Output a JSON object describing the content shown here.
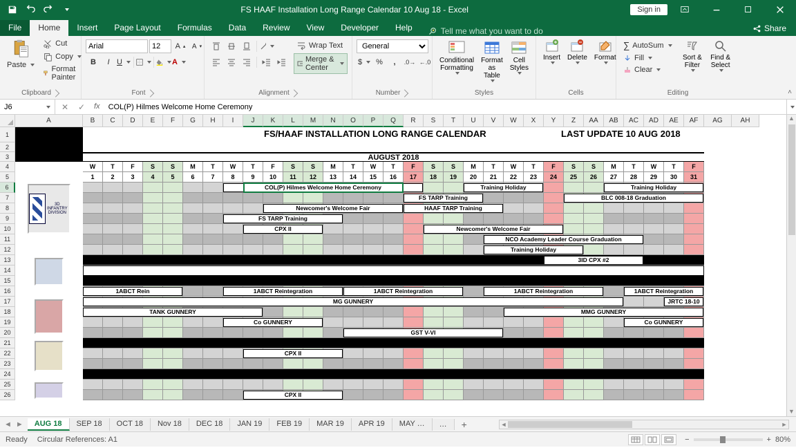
{
  "titlebar": {
    "doc_title": "FS HAAF Installation Long Range Calendar 10 Aug 18  -  Excel",
    "signin": "Sign in"
  },
  "menu": {
    "items": [
      "File",
      "Home",
      "Insert",
      "Page Layout",
      "Formulas",
      "Data",
      "Review",
      "View",
      "Developer",
      "Help"
    ],
    "active": "Home",
    "tell_placeholder": "Tell me what you want to do",
    "share": "Share"
  },
  "ribbon": {
    "clipboard": {
      "paste": "Paste",
      "cut": "Cut",
      "copy": "Copy",
      "painter": "Format Painter",
      "label": "Clipboard"
    },
    "font": {
      "name": "Arial",
      "size": "12",
      "label": "Font"
    },
    "alignment": {
      "wrap": "Wrap Text",
      "merge": "Merge & Center",
      "label": "Alignment"
    },
    "number": {
      "format": "General",
      "label": "Number"
    },
    "styles": {
      "cond": "Conditional Formatting",
      "table": "Format as Table",
      "cell": "Cell Styles",
      "label": "Styles"
    },
    "cells": {
      "insert": "Insert",
      "delete": "Delete",
      "format": "Format",
      "label": "Cells"
    },
    "editing": {
      "autosum": "AutoSum",
      "fill": "Fill",
      "clear": "Clear",
      "sort": "Sort & Filter",
      "find": "Find & Select",
      "label": "Editing"
    }
  },
  "namebox": {
    "cell": "J6",
    "formula": "COL(P) Hilmes Welcome Home Ceremony"
  },
  "columns": [
    "A",
    "B",
    "C",
    "D",
    "E",
    "F",
    "G",
    "H",
    "I",
    "J",
    "K",
    "L",
    "M",
    "N",
    "O",
    "P",
    "Q",
    "R",
    "S",
    "T",
    "U",
    "V",
    "W",
    "X",
    "Y",
    "Z",
    "AA",
    "AB",
    "AC",
    "AD",
    "AE",
    "AF",
    "AG",
    "AH"
  ],
  "sheet": {
    "title": "FS/HAAF INSTALLATION LONG RANGE CALENDAR",
    "update": "LAST UPDATE 10 AUG 2018",
    "month": "AUGUST 2018",
    "dow": [
      "W",
      "T",
      "F",
      "S",
      "S",
      "M",
      "T",
      "W",
      "T",
      "F",
      "S",
      "S",
      "M",
      "T",
      "W",
      "T",
      "F",
      "S",
      "S",
      "M",
      "T",
      "W",
      "T",
      "F",
      "S",
      "S",
      "M",
      "T",
      "W",
      "T",
      "F"
    ],
    "dom": [
      "1",
      "2",
      "3",
      "4",
      "5",
      "6",
      "7",
      "8",
      "9",
      "10",
      "11",
      "12",
      "13",
      "14",
      "15",
      "16",
      "17",
      "18",
      "19",
      "20",
      "21",
      "22",
      "23",
      "24",
      "25",
      "26",
      "27",
      "28",
      "29",
      "30",
      "31"
    ],
    "weekend_idx": [
      3,
      4,
      10,
      11,
      17,
      18,
      24,
      25
    ],
    "red_idx": [
      16,
      23,
      30
    ],
    "unit0": "3D INFANTRY DIVISION",
    "events": {
      "r6": [
        {
          "from": 8,
          "to": 17,
          "t": "COL(P) Hilmes Welcome Home Ceremony"
        },
        {
          "from": 20,
          "to": 23,
          "t": "Training Holiday"
        },
        {
          "from": 27,
          "to": 31,
          "t": "Training Holiday"
        }
      ],
      "r7": [
        {
          "from": 17,
          "to": 20,
          "t": "FS TARP Training"
        },
        {
          "from": 25,
          "to": 31,
          "t": "BLC 008-18 Graduation"
        }
      ],
      "r8": [
        {
          "from": 10,
          "to": 16,
          "t": "Newcomer's Welcome Fair"
        },
        {
          "from": 17,
          "to": 21,
          "t": "HAAF TARP Training"
        }
      ],
      "r9": [
        {
          "from": 8,
          "to": 13,
          "t": "FS TARP Training"
        }
      ],
      "r10": [
        {
          "from": 9,
          "to": 12,
          "t": "CPX II"
        },
        {
          "from": 18,
          "to": 24,
          "t": "Newcomer's Welcome Fair"
        }
      ],
      "r11": [
        {
          "from": 21,
          "to": 28,
          "t": "NCO Academy Leader Course Graduation"
        }
      ],
      "r12": [
        {
          "from": 21,
          "to": 25,
          "t": "Training Holiday"
        }
      ],
      "r13": [
        {
          "from": 24,
          "to": 28,
          "t": "3ID CPX #2"
        }
      ],
      "r16": [
        {
          "from": 1,
          "to": 5,
          "t": "1ABCT Rein"
        },
        {
          "from": 8,
          "to": 13,
          "t": "1ABCT Reintegration"
        },
        {
          "from": 14,
          "to": 19,
          "t": "1ABCT Reintegration"
        },
        {
          "from": 21,
          "to": 26,
          "t": "1ABCT Reintegration"
        },
        {
          "from": 28,
          "to": 32,
          "t": "1ABCT Reintegration"
        }
      ],
      "r17": [
        {
          "from": 1,
          "to": 27,
          "t": "MG GUNNERY"
        },
        {
          "from": 30,
          "to": 32,
          "t": "JRTC 18-10"
        }
      ],
      "r18": [
        {
          "from": 1,
          "to": 9,
          "t": "TANK GUNNERY"
        },
        {
          "from": 22,
          "to": 32,
          "t": "MMG GUNNERY"
        }
      ],
      "r19": [
        {
          "from": 8,
          "to": 12,
          "t": "Co GUNNERY"
        },
        {
          "from": 28,
          "to": 32,
          "t": "Co GUNNERY"
        }
      ],
      "r20": [
        {
          "from": 14,
          "to": 21,
          "t": "GST V-VI"
        }
      ],
      "r22": [
        {
          "from": 9,
          "to": 13,
          "t": "CPX II"
        }
      ],
      "r26": [
        {
          "from": 9,
          "to": 13,
          "t": "CPX II"
        }
      ]
    },
    "row_bg": {
      "6": "lgray",
      "7": "dgray",
      "8": "lgray",
      "9": "dgray",
      "10": "lgray",
      "11": "dgray",
      "12": "lgray",
      "13": "black",
      "14": "w",
      "15": "black",
      "16": "dgray",
      "17": "lgray",
      "18": "dgray",
      "19": "lgray",
      "20": "dgray",
      "21": "black",
      "22": "lgray",
      "23": "dgray",
      "24": "black",
      "25": "lgray",
      "26": "dgray"
    }
  },
  "tabs": {
    "list": [
      "AUG 18",
      "SEP 18",
      "OCT 18",
      "Nov 18",
      "DEC 18",
      "JAN 19",
      "FEB 19",
      "MAR 19",
      "APR 19",
      "MAY …"
    ],
    "active": "AUG 18",
    "more": "…",
    "add": "+"
  },
  "status": {
    "ready": "Ready",
    "circ": "Circular References: A1",
    "zoom": "80%"
  }
}
